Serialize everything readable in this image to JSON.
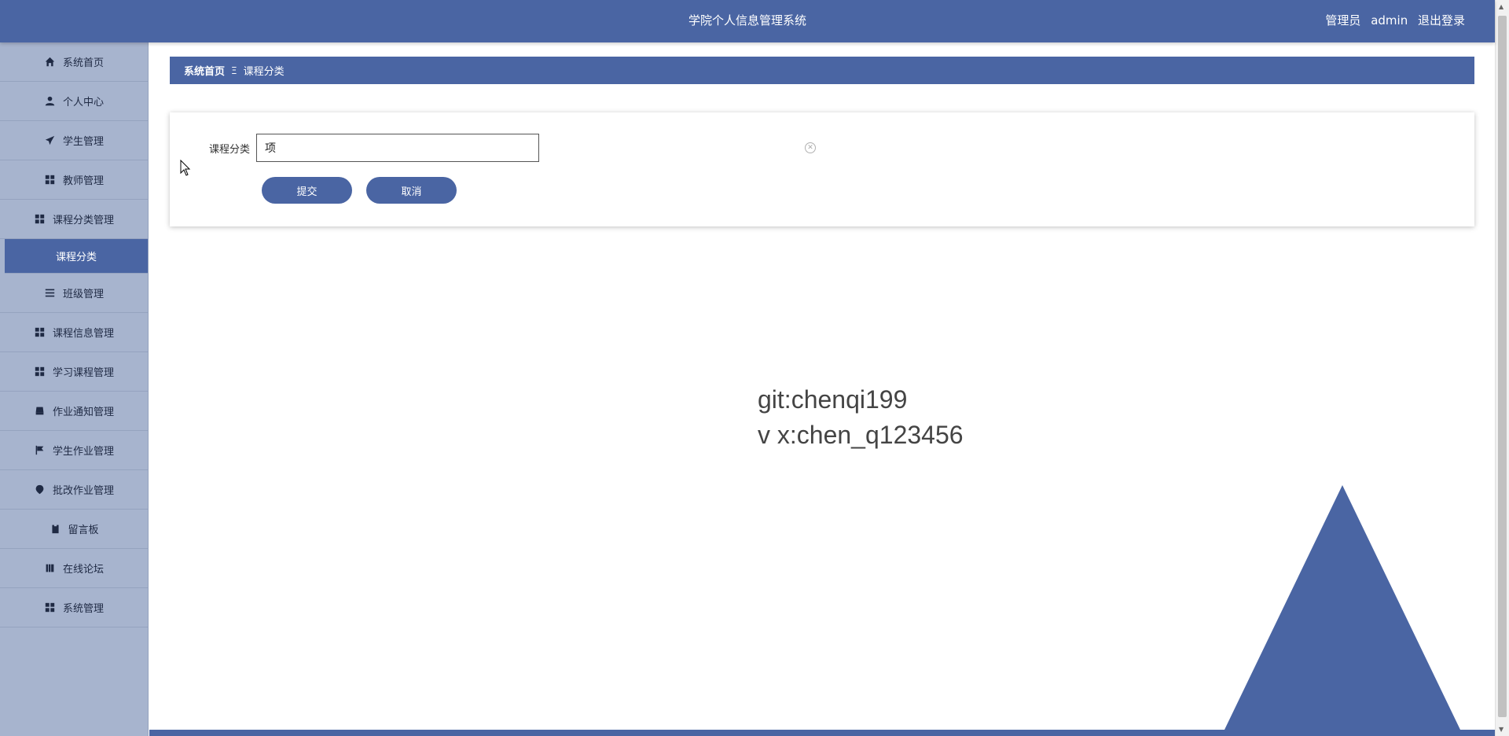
{
  "header": {
    "title": "学院个人信息管理系统",
    "role_label": "管理员",
    "username": "admin",
    "logout_label": "退出登录"
  },
  "sidebar": {
    "items": [
      {
        "label": "系统首页",
        "icon": "home-icon"
      },
      {
        "label": "个人中心",
        "icon": "user-icon"
      },
      {
        "label": "学生管理",
        "icon": "paper-plane-icon"
      },
      {
        "label": "教师管理",
        "icon": "grid-icon"
      },
      {
        "label": "课程分类管理",
        "icon": "grid-icon"
      },
      {
        "label": "课程分类",
        "icon": "",
        "active": true
      },
      {
        "label": "班级管理",
        "icon": "list-icon"
      },
      {
        "label": "课程信息管理",
        "icon": "grid-icon"
      },
      {
        "label": "学习课程管理",
        "icon": "grid-icon"
      },
      {
        "label": "作业通知管理",
        "icon": "inbox-icon"
      },
      {
        "label": "学生作业管理",
        "icon": "flag-icon"
      },
      {
        "label": "批改作业管理",
        "icon": "location-icon"
      },
      {
        "label": "留言板",
        "icon": "clipboard-icon"
      },
      {
        "label": "在线论坛",
        "icon": "book-icon"
      },
      {
        "label": "系统管理",
        "icon": "grid-icon"
      }
    ]
  },
  "breadcrumb": {
    "home": "系统首页",
    "separator": "Ξ",
    "current": "课程分类"
  },
  "form": {
    "label": "课程分类",
    "value": "项",
    "submit_label": "提交",
    "cancel_label": "取消"
  },
  "watermark": {
    "line1": "git:chenqi199",
    "line2": "v x:chen_q123456"
  },
  "colors": {
    "primary": "#4a65a3",
    "sidebar": "#a7b4ce"
  }
}
